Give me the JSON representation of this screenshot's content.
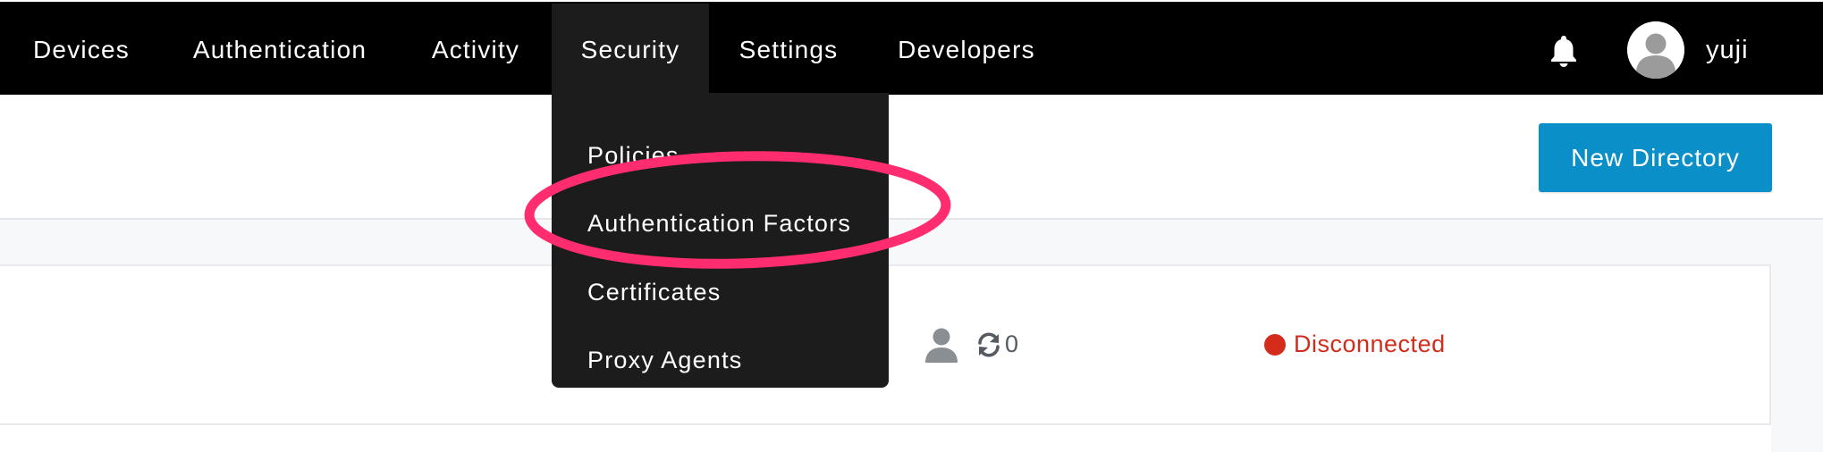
{
  "nav": {
    "items": [
      {
        "label": "Devices"
      },
      {
        "label": "Authentication"
      },
      {
        "label": "Activity"
      },
      {
        "label": "Security"
      },
      {
        "label": "Settings"
      },
      {
        "label": "Developers"
      }
    ],
    "active": "Security",
    "user": {
      "name": "yuji",
      "avatar_icon": "user-avatar-icon"
    },
    "notifications_icon": "bell-icon"
  },
  "security_menu": {
    "items": [
      {
        "label": "Policies"
      },
      {
        "label": "Authentication Factors"
      },
      {
        "label": "Certificates"
      },
      {
        "label": "Proxy Agents"
      }
    ],
    "highlighted": "Authentication Factors",
    "highlight_color": "#ff2d6f"
  },
  "header": {
    "new_directory_label": "New Directory",
    "button_color": "#0a8fc8"
  },
  "directory_row": {
    "user_icon": "user-icon",
    "sync_icon": "sync-icon",
    "sync_count": "0",
    "status": "Disconnected",
    "status_color": "#d42c1c"
  }
}
